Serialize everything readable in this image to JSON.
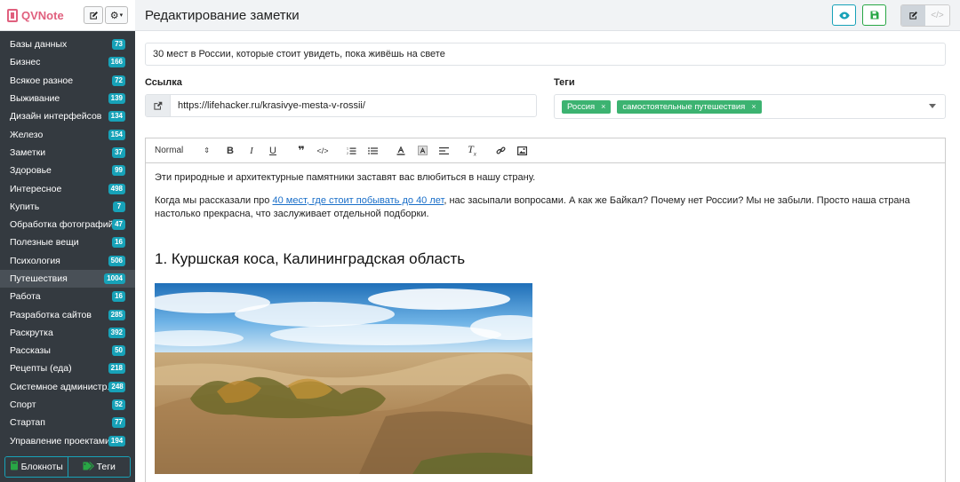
{
  "app": {
    "name": "QVNote"
  },
  "header": {
    "title": "Редактирование заметки"
  },
  "sidebar": {
    "notebooks": [
      {
        "label": "Базы данных",
        "count": "73"
      },
      {
        "label": "Бизнес",
        "count": "166"
      },
      {
        "label": "Всякое разное",
        "count": "72"
      },
      {
        "label": "Выживание",
        "count": "139"
      },
      {
        "label": "Дизайн интерфейсов",
        "count": "134"
      },
      {
        "label": "Железо",
        "count": "154"
      },
      {
        "label": "Заметки",
        "count": "37"
      },
      {
        "label": "Здоровье",
        "count": "99"
      },
      {
        "label": "Интересное",
        "count": "498"
      },
      {
        "label": "Купить",
        "count": "7"
      },
      {
        "label": "Обработка фотографий",
        "count": "47"
      },
      {
        "label": "Полезные вещи",
        "count": "16"
      },
      {
        "label": "Психология",
        "count": "506"
      },
      {
        "label": "Путешествия",
        "count": "1004"
      },
      {
        "label": "Работа",
        "count": "16"
      },
      {
        "label": "Разработка сайтов",
        "count": "285"
      },
      {
        "label": "Раскрутка",
        "count": "392"
      },
      {
        "label": "Рассказы",
        "count": "50"
      },
      {
        "label": "Рецепты (еда)",
        "count": "218"
      },
      {
        "label": "Системное администр...",
        "count": "248"
      },
      {
        "label": "Спорт",
        "count": "52"
      },
      {
        "label": "Стартап",
        "count": "77"
      },
      {
        "label": "Управление проектами",
        "count": "194"
      }
    ],
    "footer": {
      "notebooks_label": "Блокноты",
      "tags_label": "Теги"
    }
  },
  "note": {
    "title": "30 мест в России, которые стоит увидеть, пока живёшь на свете",
    "link_label": "Ссылка",
    "link": "https://lifehacker.ru/krasivye-mesta-v-rossii/",
    "tags_label": "Теги",
    "tags": [
      "Россия",
      "самостоятельные путешествия"
    ]
  },
  "toolbar": {
    "format": "Normal"
  },
  "content": {
    "p1": "Эти природные и архитектурные памятники заставят вас влюбиться в нашу страну.",
    "p2_before": "Когда мы рассказали про ",
    "p2_link": "40 мест, где стоит побывать до 40 лет",
    "p2_after": ", нас засыпали вопросами. А как же Байкал? Почему нет России? Мы не забыли. Просто наша страна настолько прекрасна, что заслуживает отдельной подборки.",
    "h2": "1. Куршская коса, Калининградская область"
  },
  "colors": {
    "accent": "#17a2b8",
    "save": "#28a745",
    "tag": "#3cb371",
    "sidebar": "#343a40",
    "brand": "#e0607e"
  }
}
